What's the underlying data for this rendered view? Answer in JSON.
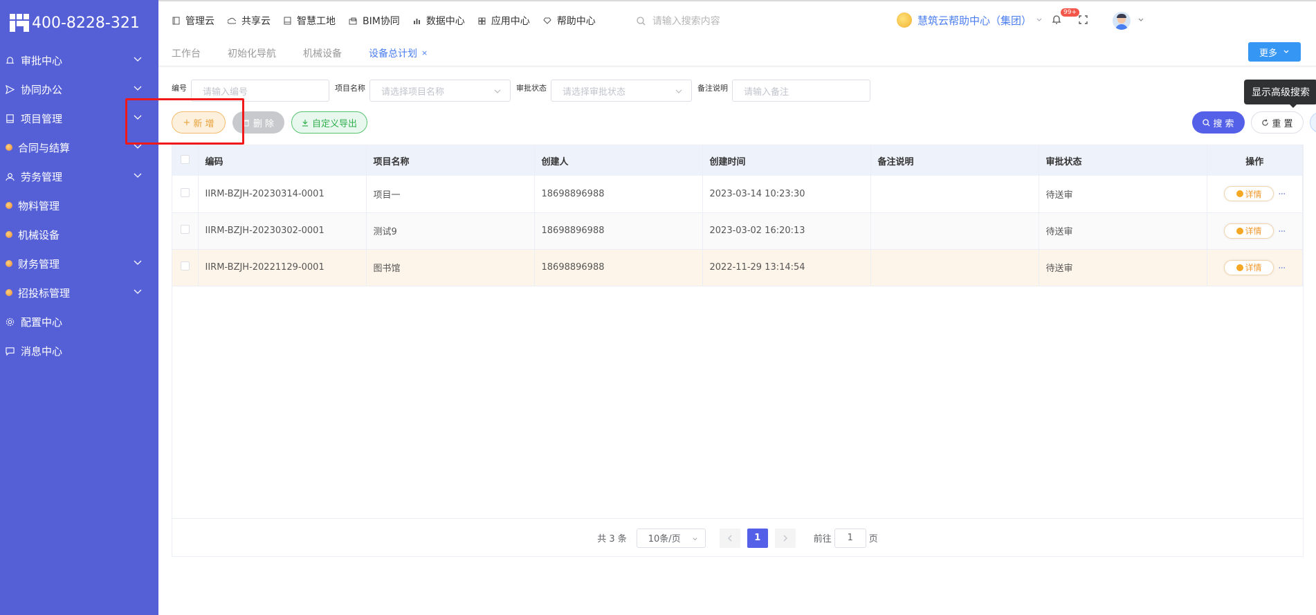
{
  "brand": {
    "phone": "400-8228-321"
  },
  "sidebar": {
    "items": [
      {
        "label": "审批中心",
        "icon": "bell-icon",
        "expandable": true
      },
      {
        "label": "协同办公",
        "icon": "send-icon",
        "expandable": true
      },
      {
        "label": "项目管理",
        "icon": "book-icon",
        "expandable": true
      },
      {
        "label": "合同与结算",
        "icon": "gem-icon",
        "expandable": true
      },
      {
        "label": "劳务管理",
        "icon": "user-icon",
        "expandable": true
      },
      {
        "label": "物料管理",
        "icon": "gem-icon",
        "expandable": false
      },
      {
        "label": "机械设备",
        "icon": "gem-icon",
        "expandable": false
      },
      {
        "label": "财务管理",
        "icon": "gem-icon",
        "expandable": true
      },
      {
        "label": "招投标管理",
        "icon": "gem-icon",
        "expandable": true
      },
      {
        "label": "配置中心",
        "icon": "gear-icon",
        "expandable": false
      },
      {
        "label": "消息中心",
        "icon": "chat-icon",
        "expandable": false
      }
    ]
  },
  "topnav": {
    "items": [
      "管理云",
      "共享云",
      "智慧工地",
      "BIM协同",
      "数据中心",
      "应用中心",
      "帮助中心"
    ],
    "search_placeholder": "请输入搜索内容",
    "org_name": "慧筑云帮助中心（集团）",
    "notification_badge": "99+"
  },
  "tabs": {
    "items": [
      "工作台",
      "初始化导航",
      "机械设备"
    ],
    "active": "设备总计划",
    "close": "×",
    "more_label": "更多"
  },
  "filters": {
    "code_label": "编号",
    "code_placeholder": "请输入编号",
    "project_label": "项目名称",
    "project_placeholder": "请选择项目名称",
    "status_label": "审批状态",
    "status_placeholder": "请选择审批状态",
    "remark_label": "备注说明",
    "remark_placeholder": "请输入备注"
  },
  "tooltip": "显示高级搜索",
  "actions": {
    "add": "新 增",
    "delete": "删 除",
    "export": "自定义导出",
    "search": "搜 索",
    "reset": "重 置"
  },
  "table": {
    "headers": [
      "编码",
      "项目名称",
      "创建人",
      "创建时间",
      "备注说明",
      "审批状态",
      "操作"
    ],
    "rows": [
      {
        "code": "IIRM-BZJH-20230314-0001",
        "project": "项目一",
        "creator": "18698896988",
        "time": "2023-03-14 10:23:30",
        "remark": "",
        "status": "待送审",
        "detail": "详情"
      },
      {
        "code": "IIRM-BZJH-20230302-0001",
        "project": "测试9",
        "creator": "18698896988",
        "time": "2023-03-02 16:20:13",
        "remark": "",
        "status": "待送审",
        "detail": "详情"
      },
      {
        "code": "IIRM-BZJH-20221129-0001",
        "project": "图书馆",
        "creator": "18698896988",
        "time": "2022-11-29 13:14:54",
        "remark": "",
        "status": "待送审",
        "detail": "详情"
      }
    ]
  },
  "pagination": {
    "total": "共 3 条",
    "page_size": "10条/页",
    "current": "1",
    "goto_label": "前往",
    "goto_value": "1",
    "page_suffix": "页"
  },
  "colors": {
    "sidebar": "#5560d6",
    "primary": "#5560e8",
    "highlight": "#f01818"
  }
}
